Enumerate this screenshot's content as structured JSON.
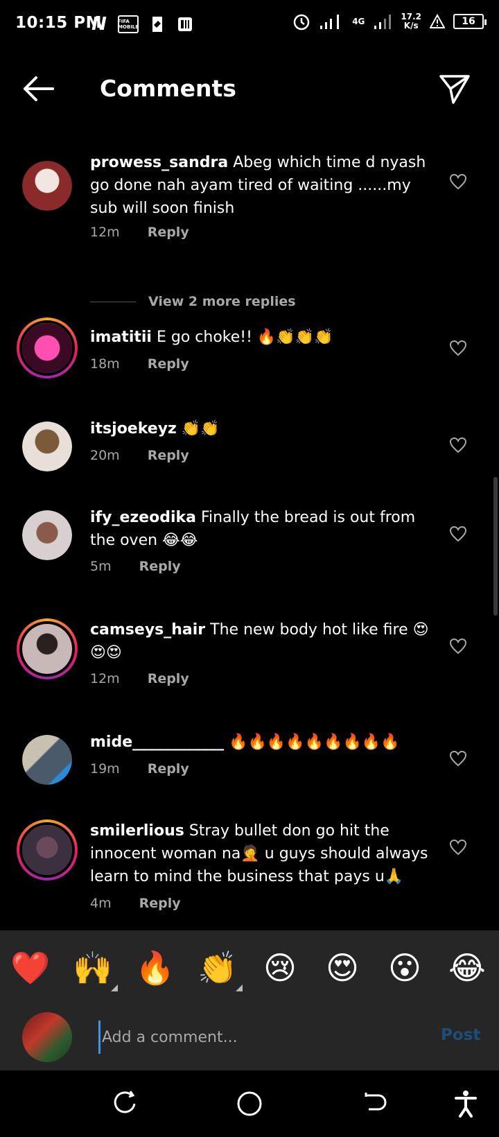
{
  "status_bar": {
    "time": "10:15 PM",
    "apps": [
      "N",
      "FIFA MOBILE"
    ],
    "network_type": "4G",
    "speed_value": "17.2",
    "speed_unit": "K/s",
    "battery": "16"
  },
  "header": {
    "title": "Comments",
    "back_icon": "arrow-left-icon",
    "send_icon": "paper-plane-icon"
  },
  "comments": [
    {
      "username": "prowess_sandra",
      "text": " Abeg which time d nyash go done nah ayam tired of waiting ......my sub will soon finish",
      "time": "12m",
      "reply": "Reply",
      "avatar_color": "#8a2a2a",
      "story_ring": false
    },
    {
      "username": "imatitii",
      "text": " E go choke!!      🔥👏👏👏",
      "time": "18m",
      "reply": "Reply",
      "avatar_color": "#e91e8c",
      "story_ring": true
    },
    {
      "username": "itsjoekeyz",
      "text": " 👏👏",
      "time": "20m",
      "reply": "Reply",
      "avatar_color": "#7a5a3a",
      "story_ring": false
    },
    {
      "username": "ify_ezeodika",
      "text": " Finally the bread is out from the oven 😂😂",
      "time": "5m",
      "reply": "Reply",
      "avatar_color": "#8a6a5a",
      "story_ring": false
    },
    {
      "username": "camseys_hair",
      "text": " The new body hot like fire 😍😍😍",
      "time": "12m",
      "reply": "Reply",
      "avatar_color": "#b8a8a8",
      "story_ring": true
    },
    {
      "username": "mide____________",
      "text": " 🔥🔥🔥🔥🔥🔥🔥🔥🔥",
      "time": "19m",
      "reply": "Reply",
      "avatar_color": "#5a6a7a",
      "story_ring": false
    },
    {
      "username": "smilerlious",
      "text": " Stray bullet don go hit the innocent woman na🤦 u guys should always learn to mind the business that pays u🙏",
      "time": "4m",
      "reply": "Reply",
      "avatar_color": "#4a3a4a",
      "story_ring": true
    }
  ],
  "view_more_replies": "View 2 more replies",
  "emoji_bar": [
    "❤️",
    "🙌",
    "🔥",
    "👏",
    "😢",
    "😍",
    "😮",
    "😂"
  ],
  "composer": {
    "placeholder": "Add a comment...",
    "post_label": "Post"
  },
  "colors": {
    "background": "#000000",
    "panel": "#262626",
    "muted_text": "#a8a8a8",
    "post_disabled": "#1c4f77"
  }
}
